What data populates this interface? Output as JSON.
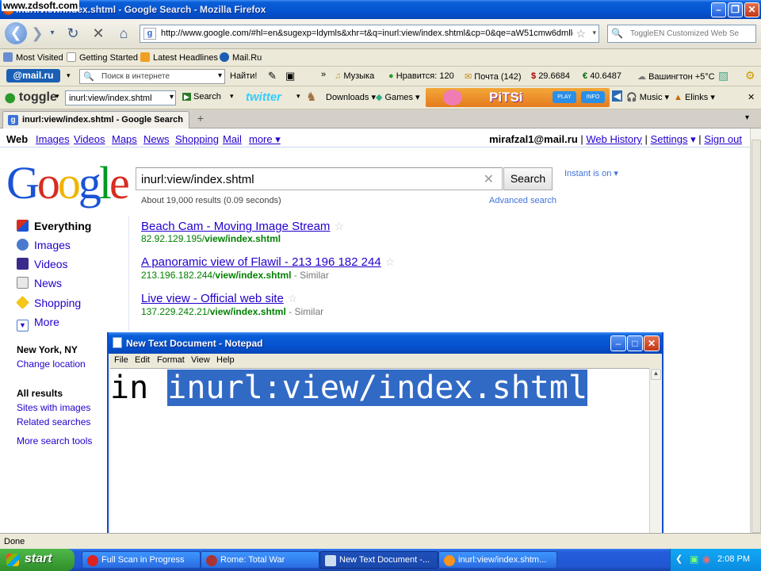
{
  "watermark": "www.zdsoft.com",
  "window": {
    "title": "inurl:view/index.shtml - Google Search - Mozilla Firefox"
  },
  "nav": {
    "url": "http://www.google.com/#hl=en&sugexp=ldymls&xhr=t&q=inurl:view/index.shtml&cp=0&qe=aW51cmw6dmlldy9p",
    "search_placeholder": "ToggleEN Customized Web Se"
  },
  "bookmarks": [
    "Most Visited",
    "Getting Started",
    "Latest Headlines",
    "Mail.Ru"
  ],
  "mailru": {
    "logo": "@mail.ru",
    "search_placeholder": "Поиск в интернете",
    "find": "Найти!",
    "items": [
      "Музыка",
      "Нравится: 120",
      "Почта (142)",
      "29.6684",
      "40.6487",
      "Вашингтон +5°C"
    ]
  },
  "togglebar": {
    "logo": "toggle",
    "input_value": "inurl:view/index.shtml",
    "search": "Search",
    "twitter": "twitter",
    "downloads": "Downloads",
    "games": "Games",
    "pitsi": "PiTSi",
    "play": "PLAY",
    "info": "INFO",
    "music": "Music",
    "elinks": "Elinks"
  },
  "tab": {
    "label": "inurl:view/index.shtml - Google Search"
  },
  "gbar": {
    "links": [
      "Web",
      "Images",
      "Videos",
      "Maps",
      "News",
      "Shopping",
      "Mail",
      "more ▾"
    ],
    "user": "mirafzal1@mail.ru",
    "web_history": "Web History",
    "settings": "Settings",
    "sign_out": "Sign out"
  },
  "search": {
    "query": "inurl:view/index.shtml",
    "button": "Search",
    "instant": "Instant is on ▾",
    "stats": "About 19,000 results (0.09 seconds)",
    "advanced": "Advanced search"
  },
  "leftnav": {
    "items": [
      "Everything",
      "Images",
      "Videos",
      "News",
      "Shopping",
      "More"
    ],
    "location_title": "New York, NY",
    "change_location": "Change location",
    "all_results": "All results",
    "sites_with_images": "Sites with images",
    "related": "Related searches",
    "more_tools": "More search tools"
  },
  "results": [
    {
      "title": "Beach Cam - Moving Image Stream",
      "url_host": "82.92.129.195/",
      "url_path": "view/index.shtml",
      "similar": ""
    },
    {
      "title": "A panoramic view of Flawil - 213 196 182 244",
      "url_host": "213.196.182.244/",
      "url_path": "view/index.shtml",
      "similar": "Similar"
    },
    {
      "title": "Live view - Official web site",
      "url_host": "137.229.242.21/",
      "url_path": "view/index.shtml",
      "similar": "Similar"
    }
  ],
  "notepad": {
    "title": "New Text Document - Notepad",
    "menu": [
      "File",
      "Edit",
      "Format",
      "View",
      "Help"
    ],
    "text_before": "in ",
    "text_selected": "inurl:view/index.shtml"
  },
  "status": "Done",
  "taskbar": {
    "start": "start",
    "tasks": [
      "Full Scan in Progress",
      "Rome: Total War",
      "New Text Document -...",
      "inurl:view/index.shtm..."
    ],
    "clock": "2:08 PM"
  }
}
